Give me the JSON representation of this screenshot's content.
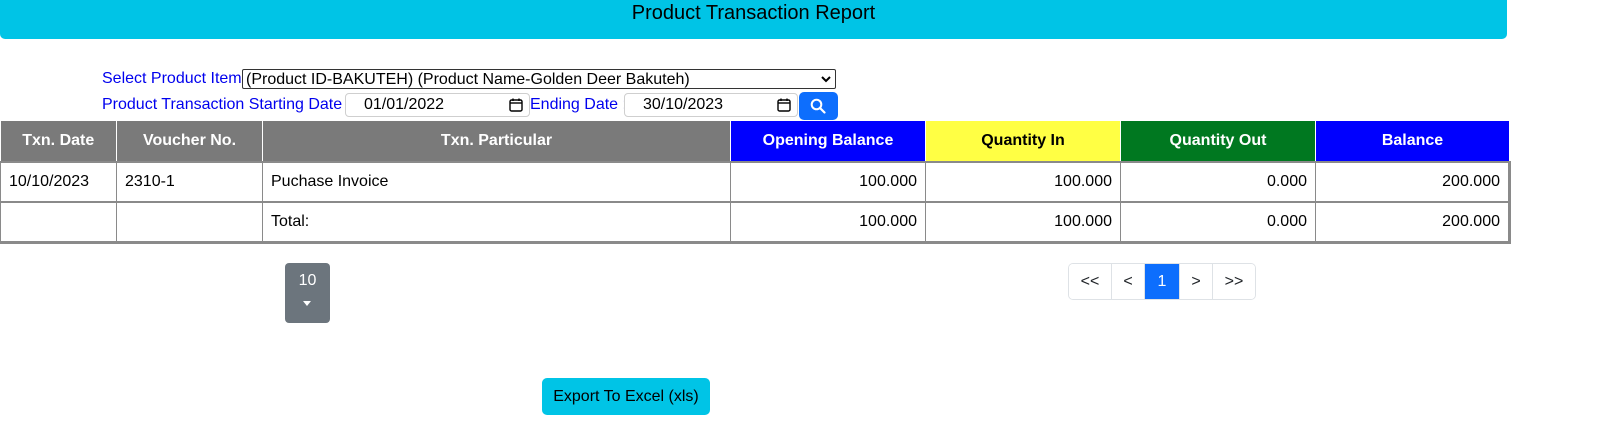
{
  "header": {
    "title": "Product Transaction Report"
  },
  "filters": {
    "product_label": "Select Product Item:",
    "product_selected": "(Product ID-BAKUTEH) (Product Name-Golden Deer Bakuteh)",
    "start_label": "Product Transaction Starting Date :",
    "start_date": "01/01/2022",
    "end_label": "Ending Date :",
    "end_date": "30/10/2023"
  },
  "table": {
    "columns": [
      {
        "label": "Txn. Date",
        "bg": "#7a7a7a",
        "fg": "#ffffff"
      },
      {
        "label": "Voucher No.",
        "bg": "#7a7a7a",
        "fg": "#ffffff"
      },
      {
        "label": "Txn. Particular",
        "bg": "#7a7a7a",
        "fg": "#ffffff"
      },
      {
        "label": "Opening Balance",
        "bg": "#0000ff",
        "fg": "#ffffff"
      },
      {
        "label": "Quantity In",
        "bg": "#ffff44",
        "fg": "#000000"
      },
      {
        "label": "Quantity Out",
        "bg": "#007820",
        "fg": "#ffffff"
      },
      {
        "label": "Balance",
        "bg": "#0000ff",
        "fg": "#ffffff"
      }
    ],
    "rows": [
      [
        "10/10/2023",
        "2310-1",
        "Puchase Invoice",
        "100.000",
        "100.000",
        "0.000",
        "200.000"
      ]
    ],
    "total": [
      "",
      "",
      "Total:",
      "100.000",
      "100.000",
      "0.000",
      "200.000"
    ]
  },
  "pagination": {
    "page_size": "10",
    "first": "<<",
    "prev": "<",
    "current": "1",
    "next": ">",
    "last": ">>"
  },
  "export": {
    "label": "Export To Excel (xls)"
  },
  "colors": {
    "accent": "#00c4e6",
    "primary": "#0d6efd",
    "label_blue": "#0000ee"
  }
}
